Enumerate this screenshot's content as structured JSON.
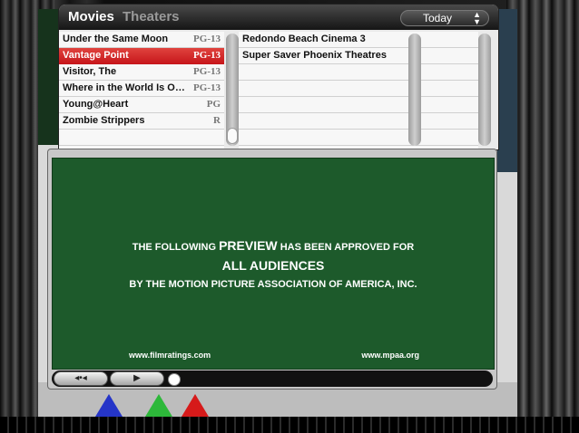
{
  "header": {
    "tab_movies": "Movies",
    "tab_theaters": "Theaters",
    "date_select": "Today"
  },
  "movies": [
    {
      "title": "Under the Same Moon",
      "rating": "PG-13",
      "selected": false
    },
    {
      "title": "Vantage Point",
      "rating": "PG-13",
      "selected": true
    },
    {
      "title": "Visitor, The",
      "rating": "PG-13",
      "selected": false
    },
    {
      "title": "Where in the World Is O…",
      "rating": "PG-13",
      "selected": false
    },
    {
      "title": "Young@Heart",
      "rating": "PG",
      "selected": false
    },
    {
      "title": "Zombie Strippers",
      "rating": "R",
      "selected": false
    }
  ],
  "theaters": [
    "Redondo Beach Cinema 3",
    "Super Saver Phoenix Theatres"
  ],
  "preview": {
    "line1_pre": "THE FOLLOWING",
    "line1_big": "PREVIEW",
    "line1_post": "HAS BEEN APPROVED FOR",
    "line2": "ALL AUDIENCES",
    "line3": "BY THE MOTION PICTURE ASSOCIATION OF AMERICA, INC.",
    "url_left": "www.filmratings.com",
    "url_right": "www.mpaa.org"
  },
  "controls": {
    "back_glyph": "◂•◂",
    "play_glyph": "▶"
  },
  "colors": {
    "selection": "#d42a2a",
    "screen_bg": "#1d5a2b"
  }
}
